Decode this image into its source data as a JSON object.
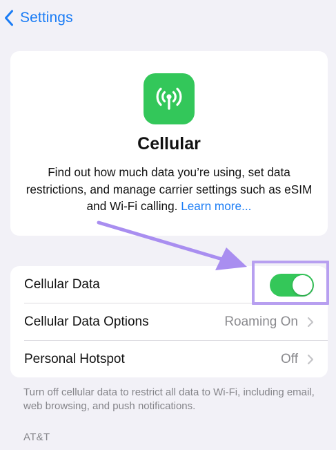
{
  "nav": {
    "back_label": "Settings"
  },
  "hero": {
    "title": "Cellular",
    "description": "Find out how much data you’re using, set data restrictions, and manage carrier settings such as eSIM and Wi-Fi calling.",
    "link_label": "Learn more..."
  },
  "rows": [
    {
      "label": "Cellular Data",
      "control": "toggle",
      "toggle_on": true
    },
    {
      "label": "Cellular Data Options",
      "value": "Roaming On"
    },
    {
      "label": "Personal Hotspot",
      "value": "Off"
    }
  ],
  "footnote": "Turn off cellular data to restrict all data to Wi-Fi, including email, web browsing, and push notifications.",
  "section_header": "AT&T",
  "colors": {
    "accent": "#1a7cf5",
    "icon_background": "#33c75a",
    "toggle_on": "#34c759",
    "annotation": "#a98ef0"
  },
  "icons": {
    "back": "chevron-left-icon",
    "app": "cellular-antenna-icon",
    "row_disclosure": "chevron-right-icon"
  }
}
